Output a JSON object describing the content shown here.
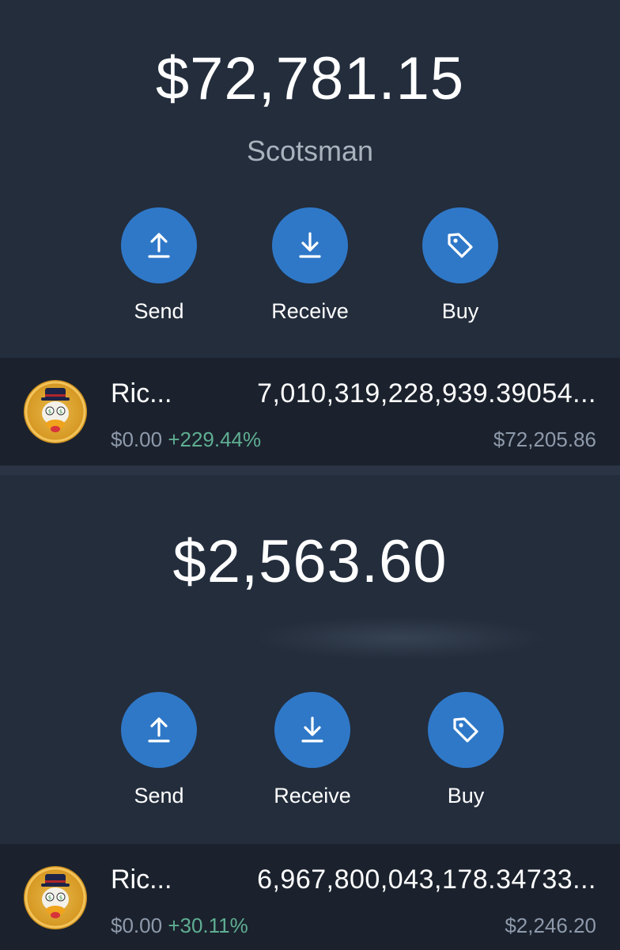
{
  "wallets": [
    {
      "balance": "$72,781.15",
      "name": "Scotsman",
      "actions": {
        "send": "Send",
        "receive": "Receive",
        "buy": "Buy"
      },
      "token": {
        "name": "Ric...",
        "amount": "7,010,319,228,939.39054...",
        "price": "$0.00",
        "change": "+229.44%",
        "value": "$72,205.86"
      }
    },
    {
      "balance": "$2,563.60",
      "actions": {
        "send": "Send",
        "receive": "Receive",
        "buy": "Buy"
      },
      "token": {
        "name": "Ric...",
        "amount": "6,967,800,043,178.34733...",
        "price": "$0.00",
        "change": "+30.11%",
        "value": "$2,246.20"
      }
    }
  ],
  "colors": {
    "background": "#232d3c",
    "row_background": "#1b222d",
    "accent": "#2f78c8",
    "positive_change": "#5fae92",
    "muted_text": "#8e9aab"
  },
  "icons": {
    "send": "send-arrow-up-icon",
    "receive": "receive-arrow-down-icon",
    "buy": "price-tag-icon",
    "token": "token-logo-icon"
  }
}
